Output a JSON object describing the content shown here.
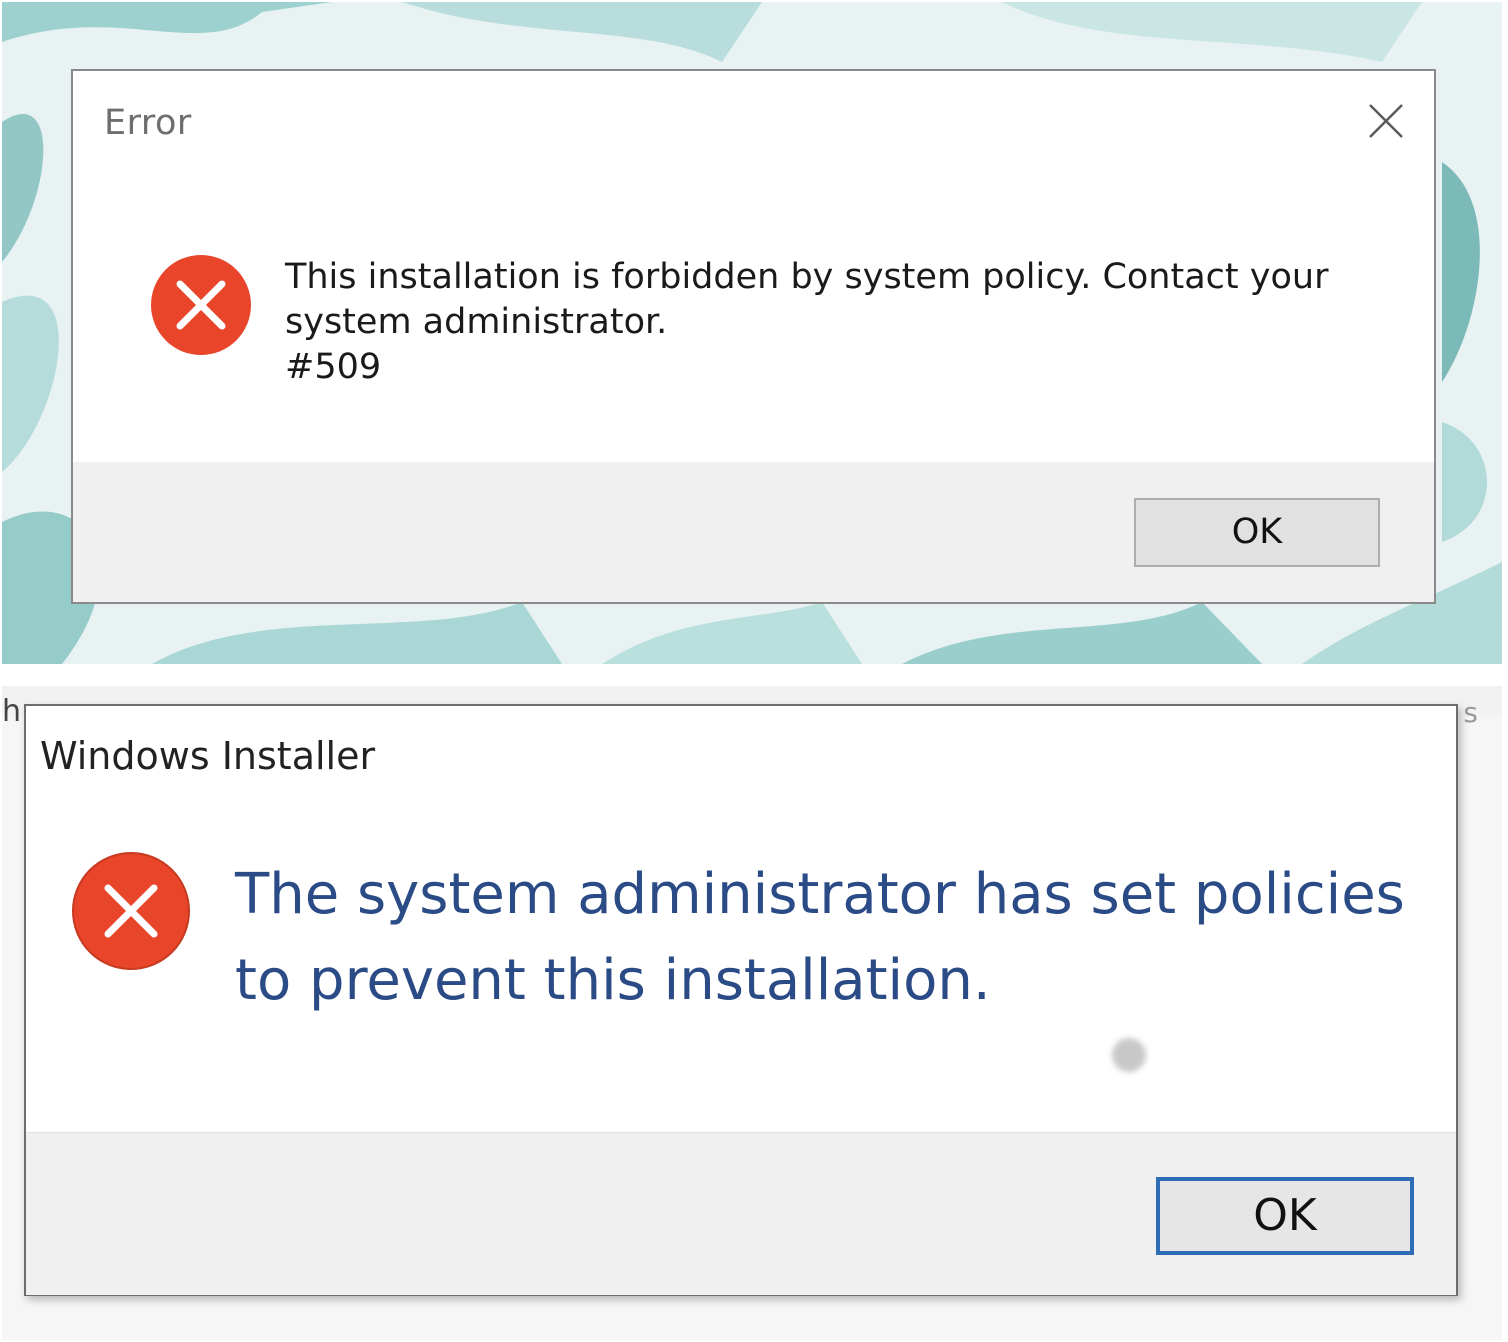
{
  "dialog_error": {
    "title": "Error",
    "message_line1": "This installation is forbidden by system policy. Contact your",
    "message_line2": "system administrator.",
    "message_line3": "#509",
    "ok_label": "OK",
    "icon": "error-icon",
    "close_icon": "close-icon"
  },
  "dialog_installer": {
    "title": "Windows Installer",
    "message_line1": "The system administrator has set policies",
    "message_line2": "to prevent this installation.",
    "ok_label": "OK",
    "icon": "error-icon"
  },
  "background": {
    "left_fragment": "h",
    "right_fragment": "s"
  },
  "colors": {
    "error_red": "#e8452a",
    "installer_text_blue": "#2a4b85",
    "focus_border_blue": "#2d6db5",
    "wallpaper_teal": "#5fb2b0"
  }
}
